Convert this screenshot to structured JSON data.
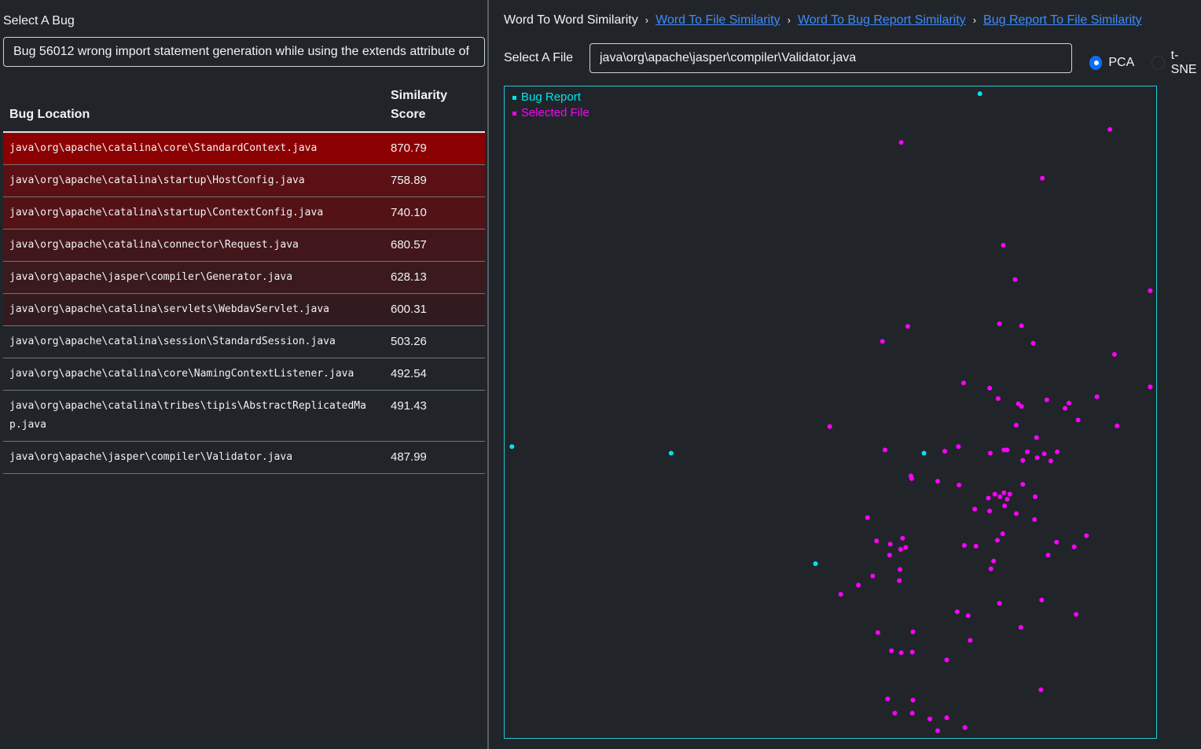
{
  "left": {
    "select_bug_label": "Select A Bug",
    "selected_bug": "Bug 56012 wrong import statement generation while using the extends attribute of",
    "table": {
      "col_location": "Bug Location",
      "col_score": "Similarity Score",
      "rows": [
        {
          "location": "java\\org\\apache\\catalina\\core\\StandardContext.java",
          "score": "870.79",
          "bg": "#8b0000"
        },
        {
          "location": "java\\org\\apache\\catalina\\startup\\HostConfig.java",
          "score": "758.89",
          "bg": "#5a1014"
        },
        {
          "location": "java\\org\\apache\\catalina\\startup\\ContextConfig.java",
          "score": "740.10",
          "bg": "#521216"
        },
        {
          "location": "java\\org\\apache\\catalina\\connector\\Request.java",
          "score": "680.57",
          "bg": "#42171b"
        },
        {
          "location": "java\\org\\apache\\jasper\\compiler\\Generator.java",
          "score": "628.13",
          "bg": "#3a1a1e"
        },
        {
          "location": "java\\org\\apache\\catalina\\servlets\\WebdavServlet.java",
          "score": "600.31",
          "bg": "#321b1f"
        },
        {
          "location": "java\\org\\apache\\catalina\\session\\StandardSession.java",
          "score": "503.26",
          "bg": "#212529"
        },
        {
          "location": "java\\org\\apache\\catalina\\core\\NamingContextListener.java",
          "score": "492.54",
          "bg": "#212529"
        },
        {
          "location": "java\\org\\apache\\catalina\\tribes\\tipis\\AbstractReplicatedMap.java",
          "score": "491.43",
          "bg": "#212529"
        },
        {
          "location": "java\\org\\apache\\jasper\\compiler\\Validator.java",
          "score": "487.99",
          "bg": "#212529"
        }
      ]
    }
  },
  "right": {
    "breadcrumb": [
      {
        "label": "Word To Word Similarity",
        "link": false
      },
      {
        "label": "Word To File Similarity",
        "link": true
      },
      {
        "label": "Word To Bug Report Similarity",
        "link": true
      },
      {
        "label": "Bug Report To File Similarity",
        "link": true
      }
    ],
    "select_file_label": "Select A File",
    "selected_file": "java\\org\\apache\\jasper\\compiler\\Validator.java",
    "projection_options": [
      {
        "label": "PCA",
        "selected": true
      },
      {
        "label": "t-SNE",
        "selected": false
      }
    ]
  },
  "chart_data": {
    "type": "scatter",
    "legend": [
      {
        "name": "Bug Report",
        "color": "#00e5ee"
      },
      {
        "name": "Selected File",
        "color": "#ff00ff"
      }
    ],
    "xlim": [
      0,
      1000
    ],
    "ylim": [
      0,
      1000
    ],
    "series": [
      {
        "name": "Bug Report",
        "color": "#00e5ee",
        "points": [
          [
            730,
            990
          ],
          [
            10,
            447
          ],
          [
            255,
            437
          ],
          [
            644,
            437
          ],
          [
            477,
            267
          ]
        ]
      },
      {
        "name": "Selected File",
        "color": "#ff00ff",
        "points": [
          [
            930,
            935
          ],
          [
            609,
            915
          ],
          [
            826,
            860
          ],
          [
            766,
            757
          ],
          [
            784,
            704
          ],
          [
            992,
            687
          ],
          [
            619,
            632
          ],
          [
            760,
            636
          ],
          [
            794,
            633
          ],
          [
            812,
            606
          ],
          [
            580,
            609
          ],
          [
            937,
            589
          ],
          [
            705,
            545
          ],
          [
            745,
            537
          ],
          [
            910,
            524
          ],
          [
            992,
            539
          ],
          [
            758,
            521
          ],
          [
            833,
            519
          ],
          [
            881,
            488
          ],
          [
            867,
            514
          ],
          [
            861,
            506
          ],
          [
            789,
            513
          ],
          [
            794,
            509
          ],
          [
            786,
            480
          ],
          [
            499,
            478
          ],
          [
            941,
            479
          ],
          [
            817,
            461
          ],
          [
            584,
            442
          ],
          [
            697,
            447
          ],
          [
            676,
            440
          ],
          [
            772,
            442
          ],
          [
            803,
            439
          ],
          [
            746,
            437
          ],
          [
            767,
            442
          ],
          [
            829,
            436
          ],
          [
            849,
            439
          ],
          [
            796,
            426
          ],
          [
            818,
            430
          ],
          [
            839,
            425
          ],
          [
            624,
            402
          ],
          [
            625,
            398
          ],
          [
            665,
            394
          ],
          [
            698,
            388
          ],
          [
            796,
            389
          ],
          [
            767,
            376
          ],
          [
            753,
            374
          ],
          [
            761,
            370
          ],
          [
            776,
            374
          ],
          [
            743,
            368
          ],
          [
            772,
            366
          ],
          [
            768,
            356
          ],
          [
            815,
            370
          ],
          [
            722,
            351
          ],
          [
            745,
            348
          ],
          [
            557,
            338
          ],
          [
            786,
            344
          ],
          [
            814,
            335
          ],
          [
            571,
            302
          ],
          [
            611,
            306
          ],
          [
            706,
            295
          ],
          [
            757,
            303
          ],
          [
            765,
            313
          ],
          [
            608,
            289
          ],
          [
            592,
            297
          ],
          [
            616,
            292
          ],
          [
            724,
            294
          ],
          [
            848,
            300
          ],
          [
            875,
            293
          ],
          [
            894,
            310
          ],
          [
            591,
            280
          ],
          [
            751,
            271
          ],
          [
            835,
            280
          ],
          [
            607,
            258
          ],
          [
            747,
            259
          ],
          [
            565,
            248
          ],
          [
            606,
            241
          ],
          [
            543,
            234
          ],
          [
            516,
            220
          ],
          [
            760,
            206
          ],
          [
            825,
            211
          ],
          [
            695,
            193
          ],
          [
            712,
            187
          ],
          [
            878,
            189
          ],
          [
            573,
            161
          ],
          [
            627,
            162
          ],
          [
            793,
            169
          ],
          [
            715,
            149
          ],
          [
            594,
            133
          ],
          [
            609,
            130
          ],
          [
            626,
            131
          ],
          [
            679,
            119
          ],
          [
            824,
            73
          ],
          [
            588,
            59
          ],
          [
            627,
            57
          ],
          [
            599,
            37
          ],
          [
            626,
            37
          ],
          [
            653,
            28
          ],
          [
            679,
            30
          ],
          [
            707,
            15
          ],
          [
            665,
            10
          ]
        ]
      }
    ]
  }
}
